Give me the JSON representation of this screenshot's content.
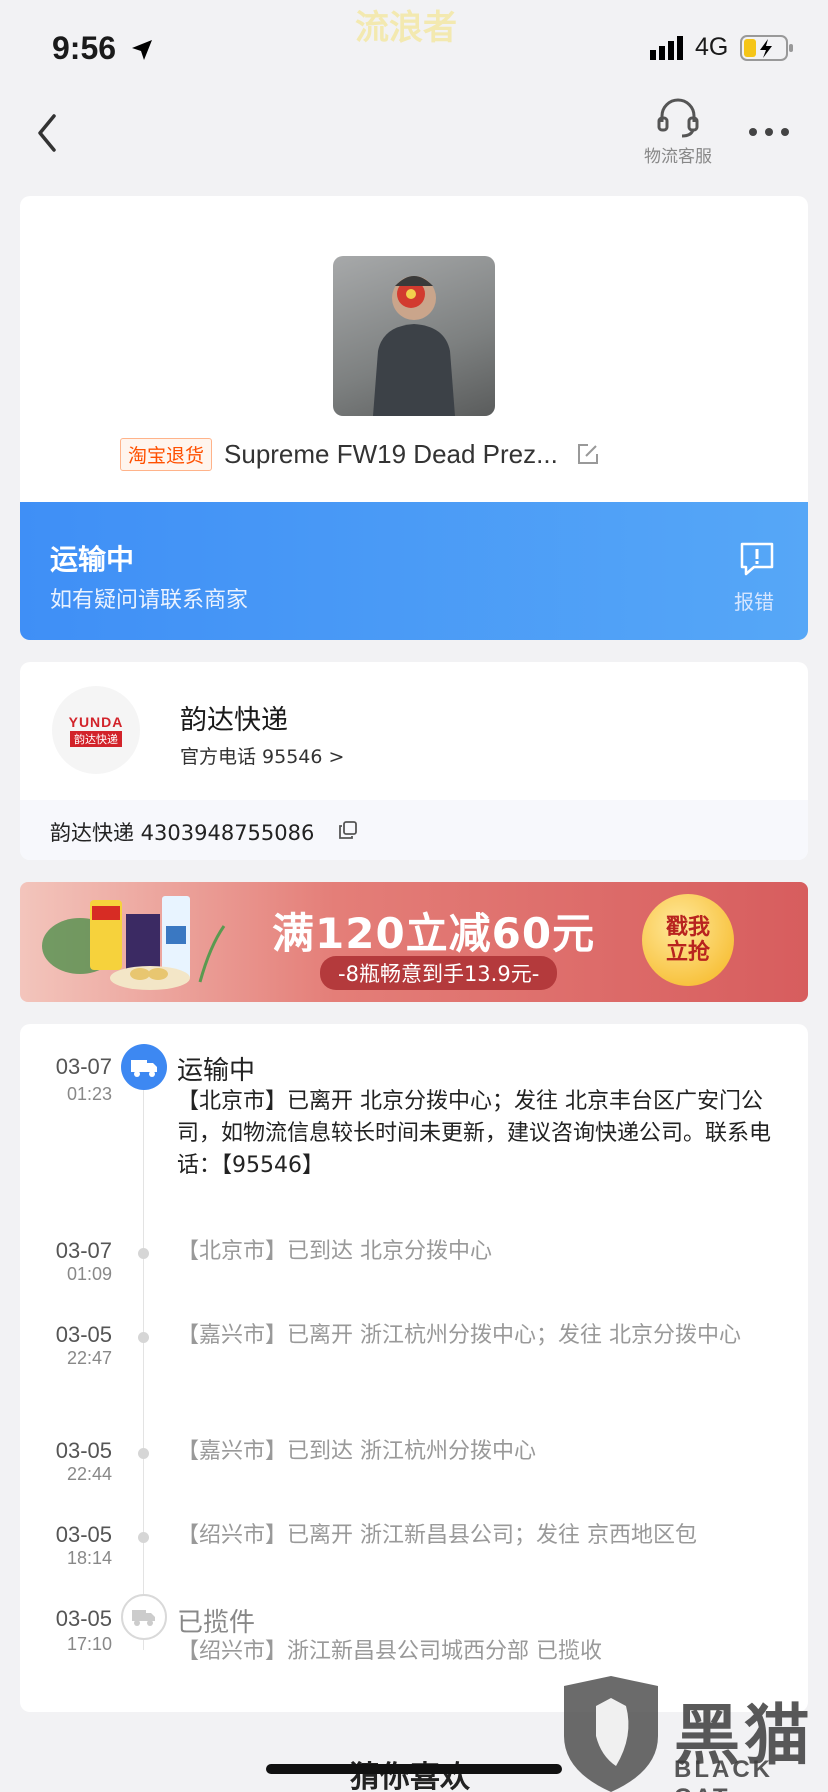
{
  "status_bar": {
    "time": "9:56",
    "network": "4G",
    "watermark": "流浪者"
  },
  "nav": {
    "service_label": "物流客服"
  },
  "product": {
    "tag": "淘宝退货",
    "title": "Supreme FW19 Dead Prez..."
  },
  "shipment_status": {
    "title": "运输中",
    "subtitle": "如有疑问请联系商家",
    "report_label": "报错"
  },
  "courier": {
    "logo_en": "YUNDA",
    "logo_cn": "韵达快递",
    "name": "韵达快递",
    "phone": "官方电话 95546 >",
    "tracking": "韵达快递 4303948755086"
  },
  "ad": {
    "title": "满120立减60元",
    "subtitle": "-8瓶畅意到手13.9元-",
    "cta": "戳我立抢"
  },
  "timeline": [
    {
      "date": "03-07",
      "time": "01:23",
      "status": "运输中",
      "desc": "【北京市】已离开 北京分拨中心；发往 北京丰台区广安门公司，如物流信息较长时间未更新，建议咨询快递公司。联系电话：【95546】"
    },
    {
      "date": "03-07",
      "time": "01:09",
      "desc": "【北京市】已到达 北京分拨中心"
    },
    {
      "date": "03-05",
      "time": "22:47",
      "desc": "【嘉兴市】已离开 浙江杭州分拨中心；发往 北京分拨中心"
    },
    {
      "date": "03-05",
      "time": "22:44",
      "desc": "【嘉兴市】已到达 浙江杭州分拨中心"
    },
    {
      "date": "03-05",
      "time": "18:14",
      "desc": "【绍兴市】已离开 浙江新昌县公司；发往 京西地区包"
    },
    {
      "date": "03-05",
      "time": "17:10",
      "status": "已揽件",
      "desc": "【绍兴市】浙江新昌县公司城西分部 已揽收"
    }
  ],
  "footer": {
    "guess_label": "猜你喜欢",
    "watermark_cn": "黑猫",
    "watermark_en": "BLACK CAT"
  }
}
